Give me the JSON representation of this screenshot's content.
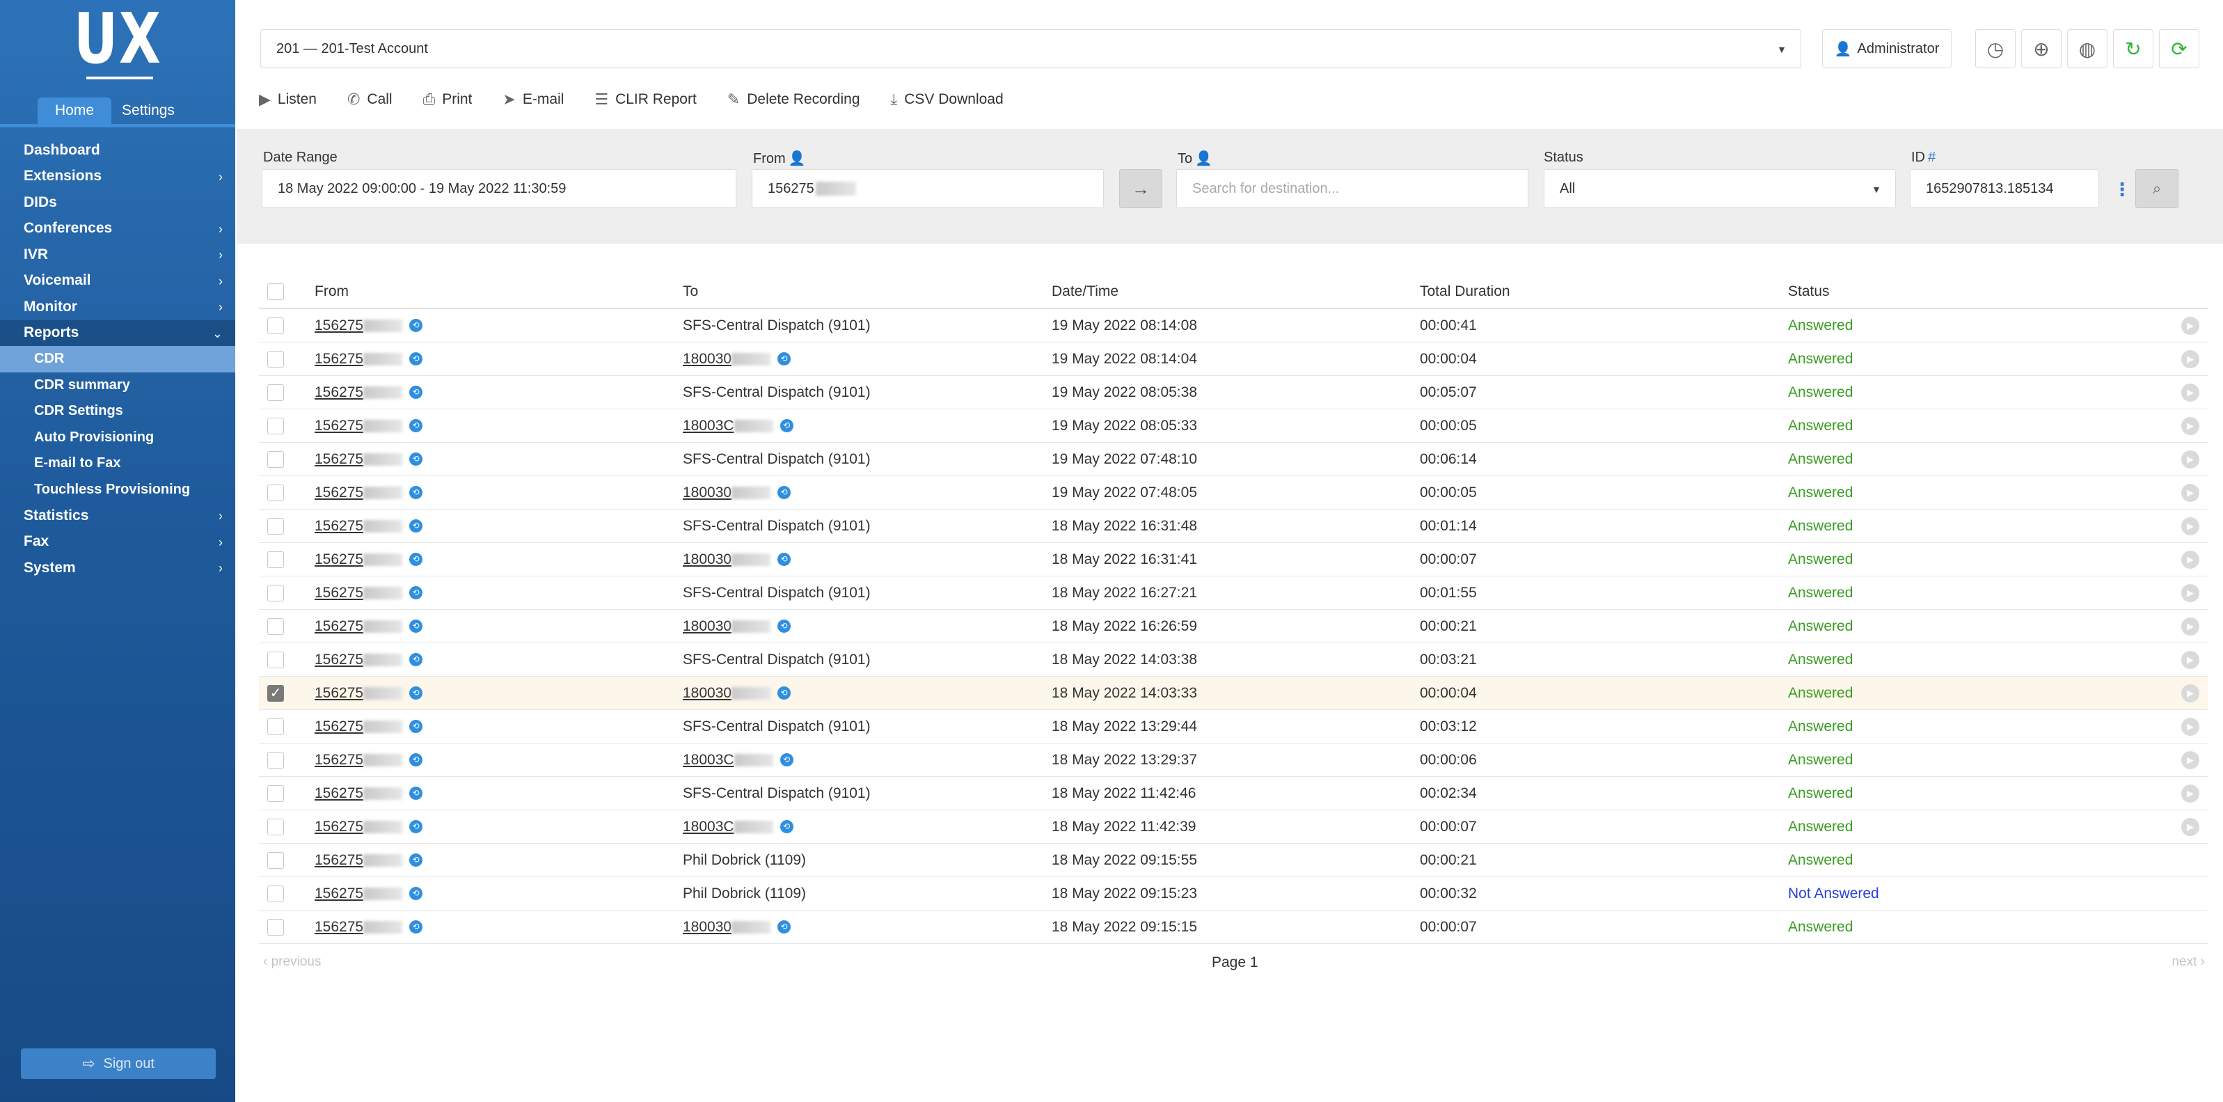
{
  "sidebar": {
    "logo": "UX",
    "tabs": [
      "Home",
      "Settings"
    ],
    "nav": [
      {
        "label": "Dashboard",
        "chevron": false
      },
      {
        "label": "Extensions",
        "chevron": true
      },
      {
        "label": "DIDs",
        "chevron": false
      },
      {
        "label": "Conferences",
        "chevron": true
      },
      {
        "label": "IVR",
        "chevron": true
      },
      {
        "label": "Voicemail",
        "chevron": true
      },
      {
        "label": "Monitor",
        "chevron": true
      },
      {
        "label": "Reports",
        "chevron": true,
        "open": true
      }
    ],
    "reports_sub": [
      "CDR",
      "CDR summary",
      "CDR Settings",
      "Auto Provisioning",
      "E-mail to Fax",
      "Touchless Provisioning"
    ],
    "nav_after": [
      {
        "label": "Statistics",
        "chevron": true
      },
      {
        "label": "Fax",
        "chevron": true
      },
      {
        "label": "System",
        "chevron": true
      }
    ],
    "signout": "Sign out"
  },
  "header": {
    "account": "201  —  201-Test Account",
    "user": "Administrator",
    "icon_buttons": [
      "clock-icon",
      "support-icon",
      "globe-icon",
      "refresh-icon",
      "sync-icon"
    ]
  },
  "toolbar": {
    "listen": "Listen",
    "call": "Call",
    "print": "Print",
    "email": "E-mail",
    "clir": "CLIR Report",
    "delete_recording": "Delete Recording",
    "csv": "CSV Download"
  },
  "filters": {
    "date_range_label": "Date Range",
    "date_range_value": "18 May 2022 09:00:00 - 19 May 2022 11:30:59",
    "from_label": "From",
    "from_value": "156275",
    "to_label": "To",
    "to_placeholder": "Search for destination...",
    "status_label": "Status",
    "status_value": "All",
    "id_label": "ID",
    "id_value": "1652907813.185134"
  },
  "table": {
    "headers": {
      "from": "From",
      "to": "To",
      "date": "Date/Time",
      "duration": "Total Duration",
      "status": "Status"
    },
    "rows": [
      {
        "from": "156275",
        "to": "SFS-Central Dispatch (9101)",
        "to_link": false,
        "date": "19 May 2022 08:14:08",
        "duration": "00:00:41",
        "status": "Answered",
        "play": true
      },
      {
        "from": "156275",
        "to": "180030",
        "to_link": true,
        "date": "19 May 2022 08:14:04",
        "duration": "00:00:04",
        "status": "Answered",
        "play": true
      },
      {
        "from": "156275",
        "to": "SFS-Central Dispatch (9101)",
        "to_link": false,
        "date": "19 May 2022 08:05:38",
        "duration": "00:05:07",
        "status": "Answered",
        "play": true
      },
      {
        "from": "156275",
        "to": "18003C",
        "to_link": true,
        "date": "19 May 2022 08:05:33",
        "duration": "00:00:05",
        "status": "Answered",
        "play": true
      },
      {
        "from": "156275",
        "to": "SFS-Central Dispatch (9101)",
        "to_link": false,
        "date": "19 May 2022 07:48:10",
        "duration": "00:06:14",
        "status": "Answered",
        "play": true
      },
      {
        "from": "156275",
        "to": "180030",
        "to_link": true,
        "date": "19 May 2022 07:48:05",
        "duration": "00:00:05",
        "status": "Answered",
        "play": true
      },
      {
        "from": "156275",
        "to": "SFS-Central Dispatch (9101)",
        "to_link": false,
        "date": "18 May 2022 16:31:48",
        "duration": "00:01:14",
        "status": "Answered",
        "play": true
      },
      {
        "from": "156275",
        "to": "180030",
        "to_link": true,
        "date": "18 May 2022 16:31:41",
        "duration": "00:00:07",
        "status": "Answered",
        "play": true
      },
      {
        "from": "156275",
        "to": "SFS-Central Dispatch (9101)",
        "to_link": false,
        "date": "18 May 2022 16:27:21",
        "duration": "00:01:55",
        "status": "Answered",
        "play": true
      },
      {
        "from": "156275",
        "to": "180030",
        "to_link": true,
        "date": "18 May 2022 16:26:59",
        "duration": "00:00:21",
        "status": "Answered",
        "play": true
      },
      {
        "from": "156275",
        "to": "SFS-Central Dispatch (9101)",
        "to_link": false,
        "date": "18 May 2022 14:03:38",
        "duration": "00:03:21",
        "status": "Answered",
        "play": true
      },
      {
        "from": "156275",
        "to": "180030",
        "to_link": true,
        "date": "18 May 2022 14:03:33",
        "duration": "00:00:04",
        "status": "Answered",
        "play": true,
        "checked": true
      },
      {
        "from": "156275",
        "to": "SFS-Central Dispatch (9101)",
        "to_link": false,
        "date": "18 May 2022 13:29:44",
        "duration": "00:03:12",
        "status": "Answered",
        "play": true
      },
      {
        "from": "156275",
        "to": "18003C",
        "to_link": true,
        "date": "18 May 2022 13:29:37",
        "duration": "00:00:06",
        "status": "Answered",
        "play": true
      },
      {
        "from": "156275",
        "to": "SFS-Central Dispatch (9101)",
        "to_link": false,
        "date": "18 May 2022 11:42:46",
        "duration": "00:02:34",
        "status": "Answered",
        "play": true
      },
      {
        "from": "156275",
        "to": "18003C",
        "to_link": true,
        "date": "18 May 2022 11:42:39",
        "duration": "00:00:07",
        "status": "Answered",
        "play": true
      },
      {
        "from": "156275",
        "to": "Phil Dobrick (1109)",
        "to_link": false,
        "date": "18 May 2022 09:15:55",
        "duration": "00:00:21",
        "status": "Answered",
        "play": false
      },
      {
        "from": "156275",
        "to": "Phil Dobrick (1109)",
        "to_link": false,
        "date": "18 May 2022 09:15:23",
        "duration": "00:00:32",
        "status": "Not Answered",
        "play": false
      },
      {
        "from": "156275",
        "to": "180030",
        "to_link": true,
        "date": "18 May 2022 09:15:15",
        "duration": "00:00:07",
        "status": "Answered",
        "play": false
      }
    ]
  },
  "pager": {
    "previous": "previous",
    "page": "Page 1",
    "next": "next"
  },
  "colors": {
    "answered": "#3a9d23",
    "not_answered": "#2a3fd6",
    "sidebar": "#1f5b9c",
    "accent": "#2e8fe0"
  }
}
